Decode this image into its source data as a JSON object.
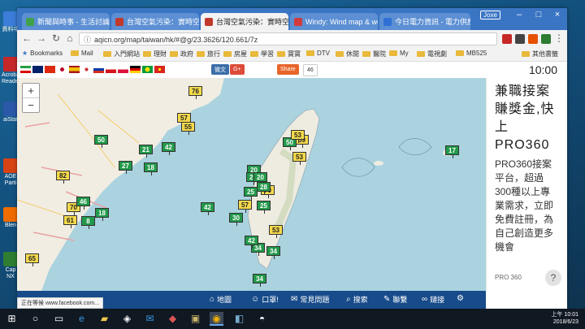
{
  "desktop": {
    "icons": [
      "資料中",
      "Acrobat Reader",
      "aiStat",
      "AOE Parti",
      "Blen",
      "Cap NX"
    ]
  },
  "browser": {
    "tabs": [
      {
        "title": "新聞與時事 - 生活討論區",
        "color": "#3fa14a"
      },
      {
        "title": "台灣空氣污染：實時空氣",
        "color": "#c0392b"
      },
      {
        "title": "台灣空氣污染：實時空氣",
        "color": "#c0392b"
      },
      {
        "title": "Windy: Wind map & we",
        "color": "#d23b3b"
      },
      {
        "title": "今日電力資訊 - 電力供應",
        "color": "#2f6fd6"
      }
    ],
    "user_label": "Joxe",
    "url": "aqicn.org/map/taiwan/hk/#@g/23.3626/120.661/7z",
    "bookmarks": [
      "Bookmarks",
      "Mail",
      "入門網站",
      "理財",
      "政府",
      "旅行",
      "房屋",
      "學習",
      "寶寶",
      "DTV",
      "休閒",
      "醫院",
      "My",
      "電視劇",
      "MB525",
      "其他書籤"
    ]
  },
  "site": {
    "flags": [
      "ir",
      "gb",
      "cn",
      "jp",
      "es",
      "kr",
      "ru",
      "cz",
      "pl",
      "de",
      "br",
      "vn"
    ],
    "share_buttons": {
      "weibo_label": "微文",
      "gplus_label": "G+",
      "share_label": "Share",
      "share_count": "46"
    },
    "time": "10:00",
    "zoom_in": "+",
    "zoom_out": "−",
    "markers": [
      {
        "v": "76",
        "level": "yellow"
      },
      {
        "v": "57",
        "level": "yellow"
      },
      {
        "v": "55",
        "level": "yellow"
      },
      {
        "v": "50",
        "level": "green"
      },
      {
        "v": "21",
        "level": "green"
      },
      {
        "v": "42",
        "level": "green"
      },
      {
        "v": "27",
        "level": "green"
      },
      {
        "v": "18",
        "level": "green"
      },
      {
        "v": "82",
        "level": "yellow"
      },
      {
        "v": "70",
        "level": "yellow"
      },
      {
        "v": "46",
        "level": "green"
      },
      {
        "v": "61",
        "level": "yellow"
      },
      {
        "v": "8",
        "level": "green"
      },
      {
        "v": "18",
        "level": "green"
      },
      {
        "v": "65",
        "level": "yellow"
      },
      {
        "v": "42",
        "level": "green"
      },
      {
        "v": "59",
        "level": "yellow"
      },
      {
        "v": "50",
        "level": "green"
      },
      {
        "v": "53",
        "level": "yellow"
      },
      {
        "v": "53",
        "level": "yellow"
      },
      {
        "v": "20",
        "level": "green"
      },
      {
        "v": "25",
        "level": "green"
      },
      {
        "v": "20",
        "level": "green"
      },
      {
        "v": "70",
        "level": "yellow"
      },
      {
        "v": "28",
        "level": "green"
      },
      {
        "v": "25",
        "level": "green"
      },
      {
        "v": "57",
        "level": "yellow"
      },
      {
        "v": "25",
        "level": "green"
      },
      {
        "v": "30",
        "level": "green"
      },
      {
        "v": "53",
        "level": "yellow"
      },
      {
        "v": "34",
        "level": "green"
      },
      {
        "v": "42",
        "level": "green"
      },
      {
        "v": "34",
        "level": "green"
      },
      {
        "v": "34",
        "level": "green"
      },
      {
        "v": "17",
        "level": "green"
      }
    ],
    "ad": {
      "headline": "兼職接案賺獎金,快上PRO360",
      "body": "PRO360接案平台，超過300種以上專業需求，立即免費註冊，為自己創造更多機會",
      "source": "PRO 360",
      "more": "?"
    },
    "nav": [
      {
        "icon": "home-icon",
        "label": "地圖"
      },
      {
        "icon": "mask-icon",
        "label": "口罩!"
      },
      {
        "icon": "chat-icon",
        "label": "常見問題"
      },
      {
        "icon": "search-icon",
        "label": "搜索"
      },
      {
        "icon": "contact-icon",
        "label": "聯繫"
      },
      {
        "icon": "link-icon",
        "label": "鏈接"
      }
    ],
    "status_url": "正在等候 www.facebook.com..."
  },
  "taskbar": {
    "time": "上午 10:01",
    "date": "2018/6/23"
  }
}
